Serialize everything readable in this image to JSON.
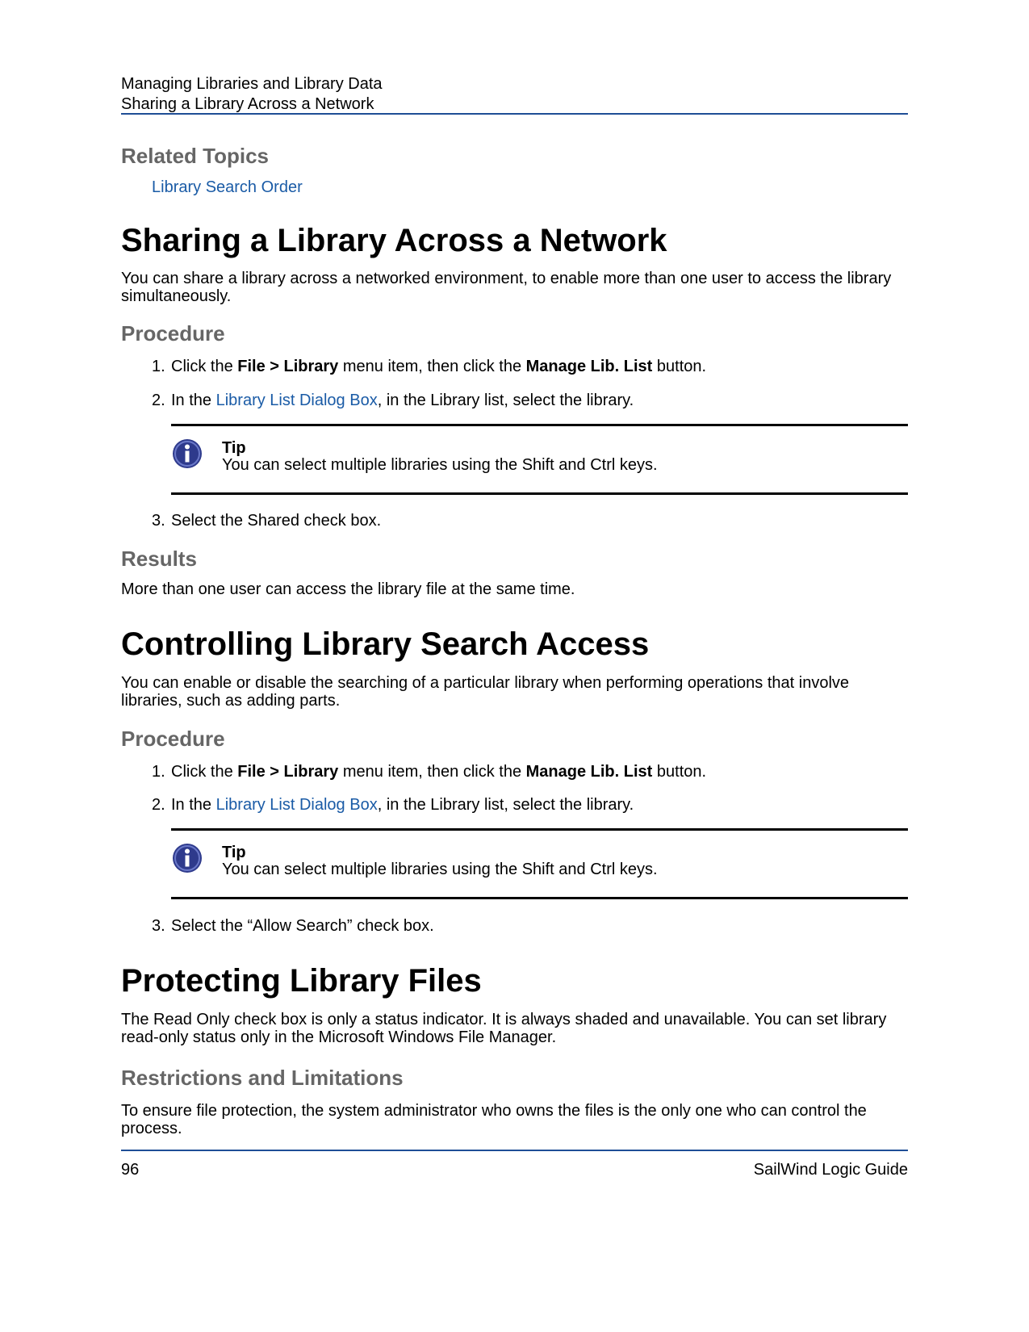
{
  "running_header": {
    "line1": "Managing Libraries and Library Data",
    "line2": "Sharing a Library Across a Network"
  },
  "related": {
    "title": "Related Topics",
    "link": "Library Search Order"
  },
  "section1": {
    "title": "Sharing a Library Across a Network",
    "intro": "You can share a library across a networked environment, to enable more than one user to access the library simultaneously.",
    "procedure_title": "Procedure",
    "step1": {
      "num": "1.",
      "t1": "Click the ",
      "b1": "File > Library",
      "t2": " menu item, then click the ",
      "b2": "Manage Lib. List",
      "t3": " button."
    },
    "step2": {
      "num": "2.",
      "t1": "In the ",
      "link": "Library List Dialog Box",
      "t2": ", in the Library list, select the library."
    },
    "tip": {
      "label": "Tip",
      "text": "You can select multiple libraries using the Shift and Ctrl keys."
    },
    "step3": {
      "num": "3.",
      "text": "Select the Shared check box."
    },
    "results_title": "Results",
    "results_text": "More than one user can access the library file at the same time."
  },
  "section2": {
    "title": "Controlling Library Search Access",
    "intro": "You can enable or disable the searching of a particular library when performing operations that involve libraries, such as adding parts.",
    "procedure_title": "Procedure",
    "step1": {
      "num": "1.",
      "t1": "Click the ",
      "b1": "File > Library",
      "t2": " menu item, then click the ",
      "b2": "Manage Lib. List",
      "t3": " button."
    },
    "step2": {
      "num": "2.",
      "t1": "In the ",
      "link": "Library List Dialog Box",
      "t2": ", in the Library list, select the library."
    },
    "tip": {
      "label": "Tip",
      "text": "You can select multiple libraries using the Shift and Ctrl keys."
    },
    "step3": {
      "num": "3.",
      "text": "Select the “Allow Search” check box."
    }
  },
  "section3": {
    "title": "Protecting Library Files",
    "intro": "The Read Only check box is only a status indicator. It is always shaded and unavailable. You can set library read-only status only in the Microsoft Windows File Manager.",
    "restrictions_title": "Restrictions and Limitations",
    "restrictions_text": "To ensure file protection, the system administrator who owns the files is the only one who can control the process."
  },
  "footer": {
    "page_number": "96",
    "guide_title": "SailWind Logic Guide"
  },
  "icons": {
    "tip": "info-icon"
  },
  "colors": {
    "rule_blue": "#1f4e96",
    "link": "#1a5ba6",
    "subheading_gray": "#666666",
    "info_icon_fill": "#2e3a8c"
  }
}
